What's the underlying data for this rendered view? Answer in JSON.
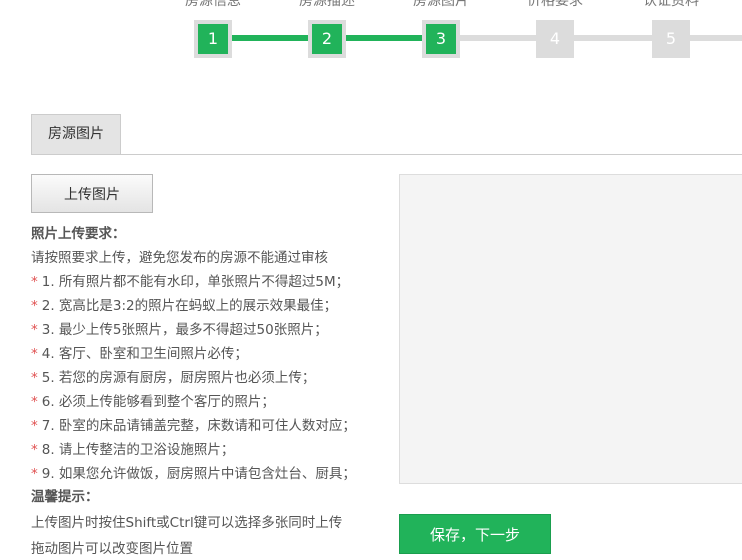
{
  "steps": [
    {
      "label": "房源信息",
      "num": "1",
      "state": "done"
    },
    {
      "label": "房源描述",
      "num": "2",
      "state": "done"
    },
    {
      "label": "房源图片",
      "num": "3",
      "state": "current"
    },
    {
      "label": "价格要求",
      "num": "4",
      "state": "todo"
    },
    {
      "label": "认证资料",
      "num": "5",
      "state": "todo"
    }
  ],
  "tab": {
    "label": "房源图片"
  },
  "upload": {
    "button_label": "上传图片"
  },
  "requirements": {
    "title": "照片上传要求：",
    "subtitle": "请按照要求上传，避免您发布的房源不能通过审核",
    "marker": "*",
    "items": [
      "1. 所有照片都不能有水印，单张照片不得超过5M；",
      "2. 宽高比是3:2的照片在蚂蚁上的展示效果最佳；",
      "3. 最少上传5张照片，最多不得超过50张照片；",
      "4. 客厅、卧室和卫生间照片必传；",
      "5. 若您的房源有厨房，厨房照片也必须上传；",
      "6. 必须上传能够看到整个客厅的照片；",
      "7. 卧室的床品请铺盖完整，床数请和可住人数对应；",
      "8. 请上传整洁的卫浴设施照片；",
      "9. 如果您允许做饭，厨房照片中请包含灶台、厨具；"
    ]
  },
  "tips": {
    "title": "温馨提示：",
    "lines": [
      "上传图片时按住Shift或Ctrl键可以选择多张同时上传",
      "拖动图片可以改变图片位置"
    ]
  },
  "save": {
    "button_label": "保存，下一步"
  },
  "colors": {
    "accent": "#21b35a",
    "inactive": "#dcdcdc",
    "star": "#e05050"
  }
}
